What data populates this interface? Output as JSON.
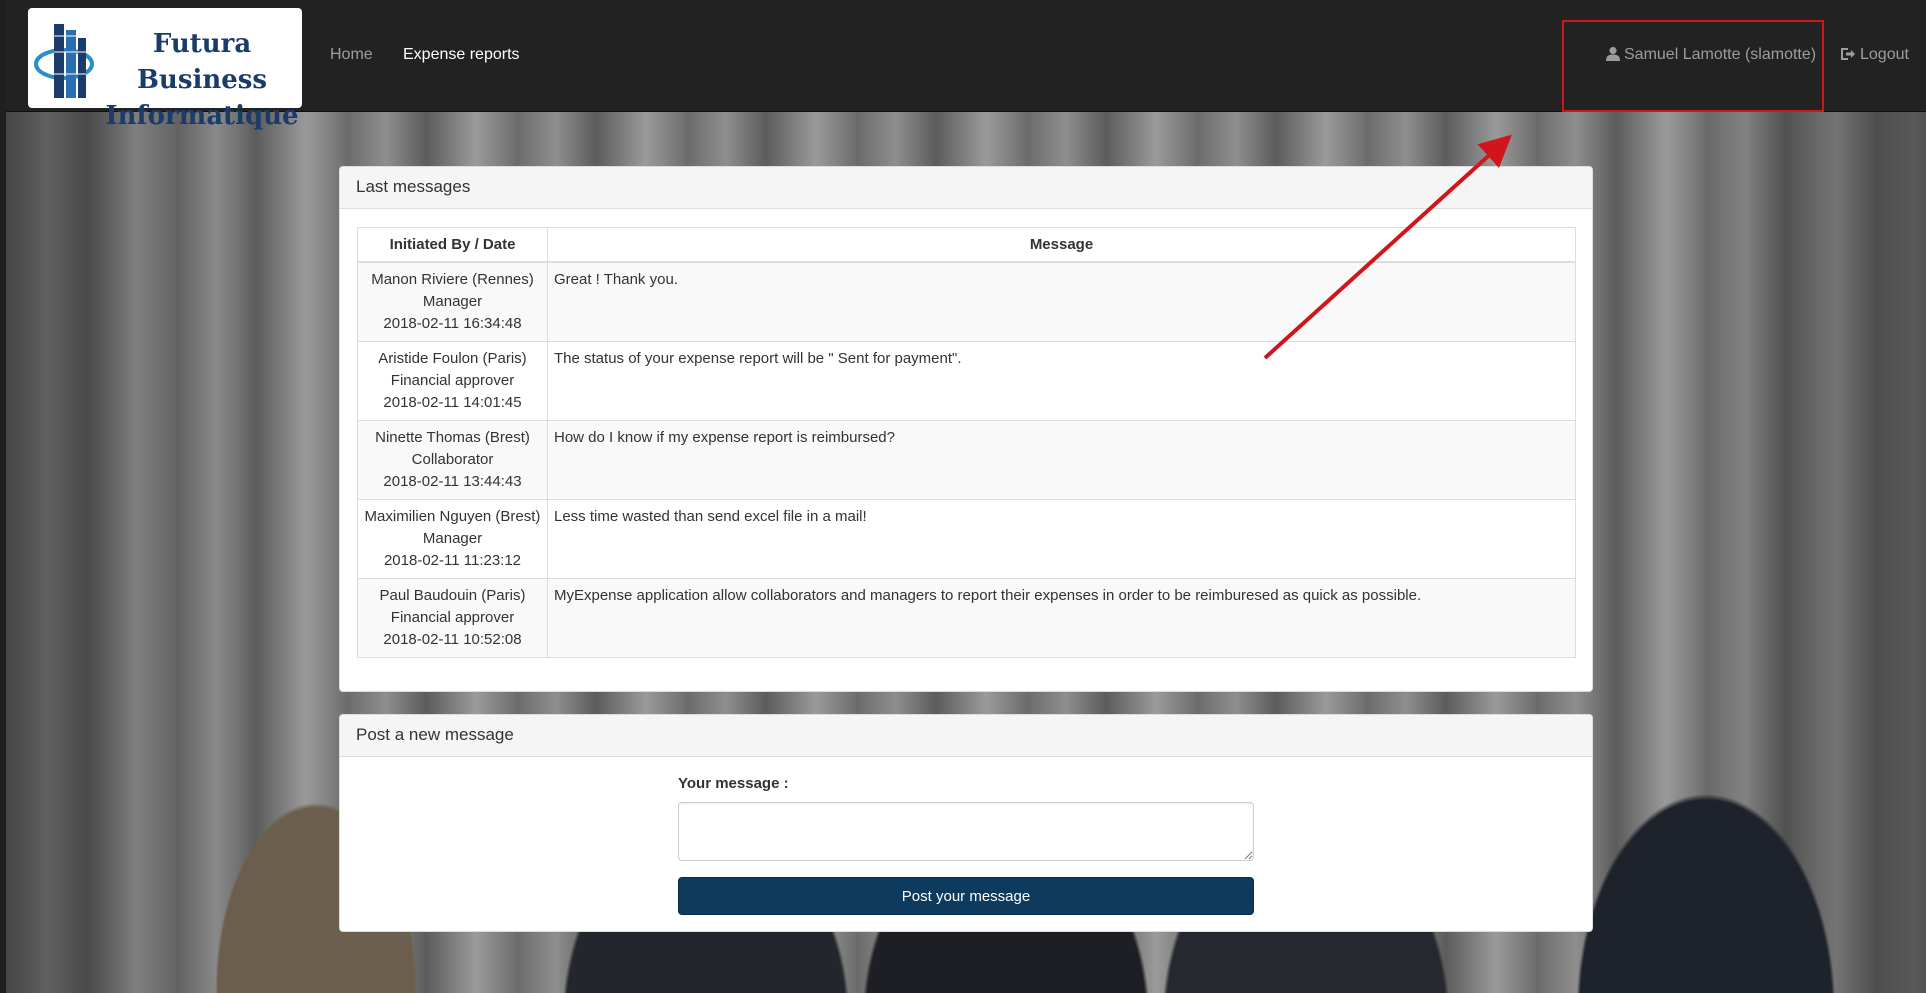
{
  "brand": {
    "line1": "Futura Business",
    "line2": "Informatique"
  },
  "nav": {
    "home": "Home",
    "expense_reports": "Expense reports",
    "user": "Samuel Lamotte (slamotte)",
    "logout": "Logout"
  },
  "messages_panel": {
    "title": "Last messages",
    "columns": [
      "Initiated By / Date",
      "Message"
    ],
    "rows": [
      {
        "name": "Manon Riviere (Rennes)",
        "role": "Manager",
        "date": "2018-02-11 16:34:48",
        "message": "Great ! Thank you."
      },
      {
        "name": "Aristide Foulon (Paris)",
        "role": "Financial approver",
        "date": "2018-02-11 14:01:45",
        "message": "The status of your expense report will be \" Sent for payment\"."
      },
      {
        "name": "Ninette Thomas (Brest)",
        "role": "Collaborator",
        "date": "2018-02-11 13:44:43",
        "message": "How do I know if my expense report is reimbursed?"
      },
      {
        "name": "Maximilien Nguyen (Brest)",
        "role": "Manager",
        "date": "2018-02-11 11:23:12",
        "message": "Less time wasted than send excel file in a mail!"
      },
      {
        "name": "Paul Baudouin (Paris)",
        "role": "Financial approver",
        "date": "2018-02-11 10:52:08",
        "message": "MyExpense application allow collaborators and managers to report their expenses in order to be reimburesed as quick as possible."
      }
    ]
  },
  "post_panel": {
    "title": "Post a new message",
    "label": "Your message :",
    "input_value": "",
    "button": "Post your message"
  },
  "colors": {
    "navbar": "#222222",
    "button": "#0e3a5e",
    "annotation": "#d0161c"
  }
}
